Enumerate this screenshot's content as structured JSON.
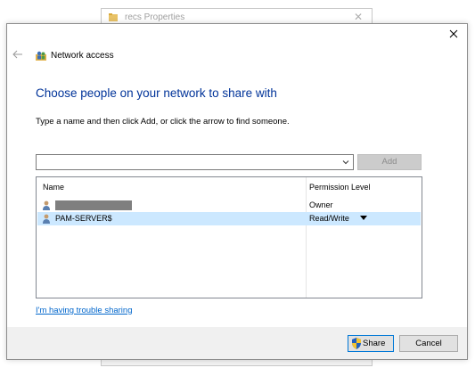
{
  "background_window": {
    "title": "recs Properties",
    "close_glyph": "✕"
  },
  "dialog": {
    "title": "Network access",
    "heading": "Choose people on your network to share with",
    "instructions": "Type a name and then click Add, or click the arrow to find someone.",
    "name_input": {
      "value": "",
      "placeholder": ""
    },
    "add_label": "Add",
    "columns": {
      "name": "Name",
      "permission": "Permission Level"
    },
    "rows": [
      {
        "name": "",
        "permission": "Owner",
        "redacted": true,
        "selected": false
      },
      {
        "name": "PAM-SERVER$",
        "permission": "Read/Write",
        "redacted": false,
        "selected": true
      }
    ],
    "trouble_link": "I'm having trouble sharing",
    "share_label": "Share",
    "cancel_label": "Cancel"
  },
  "icons": {
    "close": "close-icon",
    "back": "back-arrow-icon",
    "network": "network-people-icon",
    "folder": "folder-icon",
    "user": "user-icon",
    "shield": "uac-shield-icon",
    "dropdown": "chevron-down-icon"
  },
  "colors": {
    "heading_blue": "#003399",
    "link_blue": "#0066cc",
    "selected_row": "#cce8ff",
    "primary_button_border": "#0078d7",
    "footer_bg": "#f0f0f0"
  }
}
